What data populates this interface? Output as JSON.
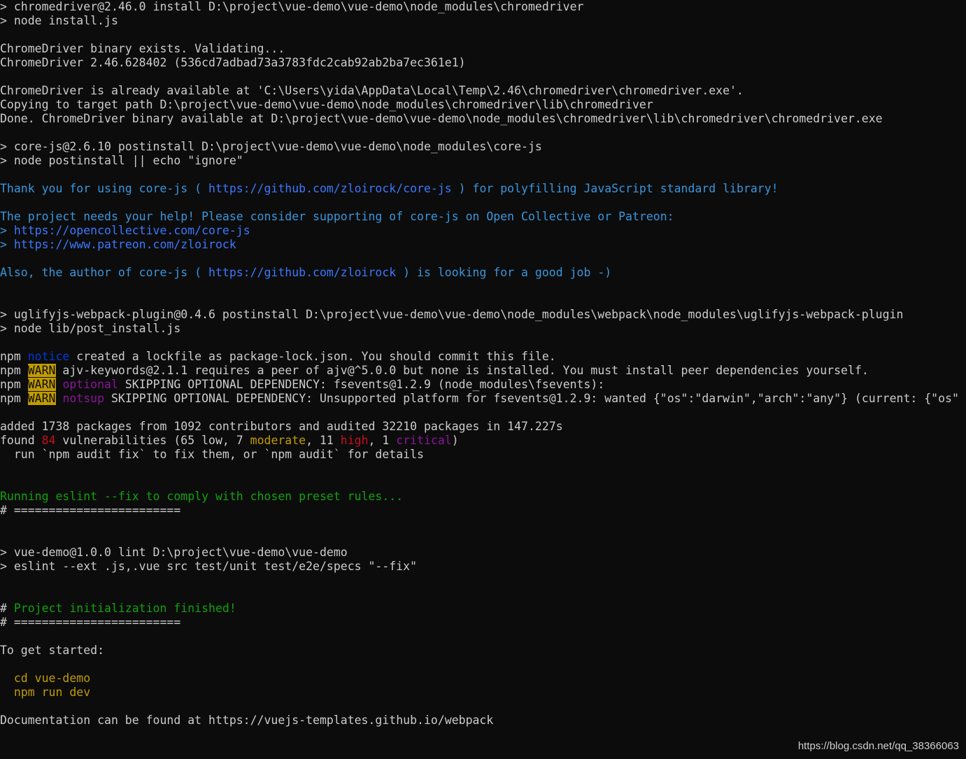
{
  "colors": {
    "background": "#0c0c0c",
    "default": "#cccccc",
    "cyan": "#3a96dd",
    "link": "#3b78ff",
    "notice_blue": "#0037da",
    "magenta": "#881798",
    "red": "#c50f1f",
    "warn_bg": "#c19c00",
    "green": "#13a10e",
    "yellow": "#c19c00"
  },
  "lines": [
    {
      "segs": [
        {
          "t": "> chromedriver@2.46.0 install D:\\project\\vue-demo\\vue-demo\\node_modules\\chromedriver",
          "c": "default"
        }
      ]
    },
    {
      "segs": [
        {
          "t": "> node install.js",
          "c": "default"
        }
      ]
    },
    {
      "segs": []
    },
    {
      "segs": [
        {
          "t": "ChromeDriver binary exists. Validating...",
          "c": "default"
        }
      ]
    },
    {
      "segs": [
        {
          "t": "ChromeDriver 2.46.628402 (536cd7adbad73a3783fdc2cab92ab2ba7ec361e1)",
          "c": "default"
        }
      ]
    },
    {
      "segs": []
    },
    {
      "segs": [
        {
          "t": "ChromeDriver is already available at 'C:\\Users\\yida\\AppData\\Local\\Temp\\2.46\\chromedriver\\chromedriver.exe'.",
          "c": "default"
        }
      ]
    },
    {
      "segs": [
        {
          "t": "Copying to target path D:\\project\\vue-demo\\vue-demo\\node_modules\\chromedriver\\lib\\chromedriver",
          "c": "default"
        }
      ]
    },
    {
      "segs": [
        {
          "t": "Done. ChromeDriver binary available at D:\\project\\vue-demo\\vue-demo\\node_modules\\chromedriver\\lib\\chromedriver\\chromedriver.exe",
          "c": "default"
        }
      ]
    },
    {
      "segs": []
    },
    {
      "segs": [
        {
          "t": "> core-js@2.6.10 postinstall D:\\project\\vue-demo\\vue-demo\\node_modules\\core-js",
          "c": "default"
        }
      ]
    },
    {
      "segs": [
        {
          "t": "> node postinstall || echo \"ignore\"",
          "c": "default"
        }
      ]
    },
    {
      "segs": []
    },
    {
      "segs": [
        {
          "t": "Thank you for using core-js ( ",
          "c": "cyan"
        },
        {
          "t": "https://github.com/zloirock/core-js",
          "c": "link"
        },
        {
          "t": " ) for polyfilling JavaScript standard library!",
          "c": "cyan"
        }
      ]
    },
    {
      "segs": []
    },
    {
      "segs": [
        {
          "t": "The project needs your help! Please consider supporting of core-js on Open Collective or Patreon:",
          "c": "cyan"
        }
      ]
    },
    {
      "segs": [
        {
          "t": "> ",
          "c": "cyan"
        },
        {
          "t": "https://opencollective.com/core-js",
          "c": "link"
        }
      ]
    },
    {
      "segs": [
        {
          "t": "> ",
          "c": "cyan"
        },
        {
          "t": "https://www.patreon.com/zloirock",
          "c": "link"
        }
      ]
    },
    {
      "segs": []
    },
    {
      "segs": [
        {
          "t": "Also, the author of core-js ( ",
          "c": "cyan"
        },
        {
          "t": "https://github.com/zloirock",
          "c": "link"
        },
        {
          "t": " ) is looking for a good job -)",
          "c": "cyan"
        }
      ]
    },
    {
      "segs": []
    },
    {
      "segs": []
    },
    {
      "segs": [
        {
          "t": "> uglifyjs-webpack-plugin@0.4.6 postinstall D:\\project\\vue-demo\\vue-demo\\node_modules\\webpack\\node_modules\\uglifyjs-webpack-plugin",
          "c": "default"
        }
      ]
    },
    {
      "segs": [
        {
          "t": "> node lib/post_install.js",
          "c": "default"
        }
      ]
    },
    {
      "segs": []
    },
    {
      "segs": [
        {
          "t": "npm ",
          "c": "default"
        },
        {
          "t": "notice",
          "c": "notice_blue"
        },
        {
          "t": " created a lockfile as package-lock.json. You should commit this file.",
          "c": "default"
        }
      ]
    },
    {
      "segs": [
        {
          "t": "npm ",
          "c": "default"
        },
        {
          "t": "WARN",
          "c": "warn"
        },
        {
          "t": " ajv-keywords@2.1.1 requires a peer of ajv@^5.0.0 but none is installed. You must install peer dependencies yourself.",
          "c": "default"
        }
      ]
    },
    {
      "segs": [
        {
          "t": "npm ",
          "c": "default"
        },
        {
          "t": "WARN",
          "c": "warn"
        },
        {
          "t": " ",
          "c": "default"
        },
        {
          "t": "optional",
          "c": "magenta"
        },
        {
          "t": " SKIPPING OPTIONAL DEPENDENCY: fsevents@1.2.9 (node_modules\\fsevents):",
          "c": "default"
        }
      ]
    },
    {
      "segs": [
        {
          "t": "npm ",
          "c": "default"
        },
        {
          "t": "WARN",
          "c": "warn"
        },
        {
          "t": " ",
          "c": "default"
        },
        {
          "t": "notsup",
          "c": "magenta"
        },
        {
          "t": " SKIPPING OPTIONAL DEPENDENCY: Unsupported platform for fsevents@1.2.9: wanted {\"os\":\"darwin\",\"arch\":\"any\"} (current: {\"os\"",
          "c": "default"
        }
      ]
    },
    {
      "segs": []
    },
    {
      "segs": [
        {
          "t": "added 1738 packages from 1092 contributors and audited 32210 packages in 147.227s",
          "c": "default"
        }
      ]
    },
    {
      "segs": [
        {
          "t": "found ",
          "c": "default"
        },
        {
          "t": "84",
          "c": "red"
        },
        {
          "t": " vulnerabilities (65 low, 7 ",
          "c": "default"
        },
        {
          "t": "moderate",
          "c": "yellow"
        },
        {
          "t": ", 11 ",
          "c": "default"
        },
        {
          "t": "high",
          "c": "red"
        },
        {
          "t": ", 1 ",
          "c": "default"
        },
        {
          "t": "critical",
          "c": "magenta"
        },
        {
          "t": ")",
          "c": "default"
        }
      ]
    },
    {
      "segs": [
        {
          "t": "  run `npm audit fix` to fix them, or `npm audit` for details",
          "c": "default"
        }
      ]
    },
    {
      "segs": []
    },
    {
      "segs": []
    },
    {
      "segs": [
        {
          "t": "Running eslint --fix to comply with chosen preset rules...",
          "c": "green"
        }
      ]
    },
    {
      "segs": [
        {
          "t": "# ========================",
          "c": "default"
        }
      ]
    },
    {
      "segs": []
    },
    {
      "segs": []
    },
    {
      "segs": [
        {
          "t": "> vue-demo@1.0.0 lint D:\\project\\vue-demo\\vue-demo",
          "c": "default"
        }
      ]
    },
    {
      "segs": [
        {
          "t": "> eslint --ext .js,.vue src test/unit test/e2e/specs \"--fix\"",
          "c": "default"
        }
      ]
    },
    {
      "segs": []
    },
    {
      "segs": []
    },
    {
      "segs": [
        {
          "t": "# ",
          "c": "default"
        },
        {
          "t": "Project initialization finished!",
          "c": "green"
        }
      ]
    },
    {
      "segs": [
        {
          "t": "# ========================",
          "c": "default"
        }
      ]
    },
    {
      "segs": []
    },
    {
      "segs": [
        {
          "t": "To get started:",
          "c": "default"
        }
      ]
    },
    {
      "segs": []
    },
    {
      "segs": [
        {
          "t": "  cd vue-demo",
          "c": "yellow"
        }
      ]
    },
    {
      "segs": [
        {
          "t": "  npm run dev",
          "c": "yellow"
        }
      ]
    },
    {
      "segs": []
    },
    {
      "segs": [
        {
          "t": "Documentation can be found at https://vuejs-templates.github.io/webpack",
          "c": "default"
        }
      ]
    }
  ],
  "watermark": "https://blog.csdn.net/qq_38366063"
}
